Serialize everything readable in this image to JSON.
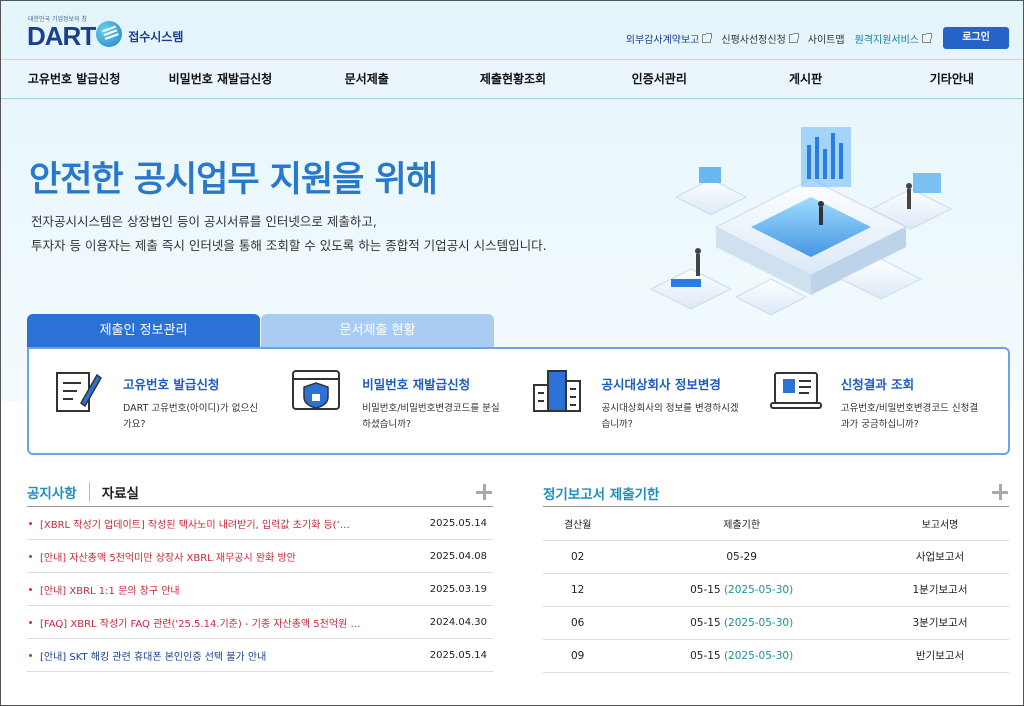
{
  "header": {
    "logo_tagline": "대한민국 기업정보의 창",
    "logo_text": "DART",
    "logo_sub": "접수시스템",
    "links": [
      {
        "label": "외부감사계약보고",
        "external": true
      },
      {
        "label": "신평사선정신청",
        "external": true
      },
      {
        "label": "사이트맵",
        "external": false
      },
      {
        "label": "원격지원서비스",
        "external": true
      }
    ],
    "login_label": "로그인"
  },
  "nav": [
    "고유번호 발급신청",
    "비밀번호 재발급신청",
    "문서제출",
    "제출현황조회",
    "인증서관리",
    "게시판",
    "기타안내"
  ],
  "hero": {
    "title": "안전한 공시업무 지원을 위해",
    "desc_line1": "전자공시시스템은 상장법인 등이 공시서류를 인터넷으로 제출하고,",
    "desc_line2": "투자자 등 이용자는 제출 즉시 인터넷을 통해 조회할 수 있도록 하는 종합적 기업공시 시스템입니다."
  },
  "tabs": {
    "active": "제출인 정보관리",
    "inactive": "문서제출 현황"
  },
  "services": [
    {
      "icon": "scroll-pen-icon",
      "title": "고유번호 발급신청",
      "desc": "DART 고유번호(아이디)가 없으신가요?"
    },
    {
      "icon": "lock-browser-icon",
      "title": "비밀번호 재발급신청",
      "desc": "비밀번호/비밀번호변경코드를 분실하셨습니까?"
    },
    {
      "icon": "buildings-icon",
      "title": "공시대상회사 정보변경",
      "desc": "공시대상회사의 정보를 변경하시겠습니까?"
    },
    {
      "icon": "laptop-document-icon",
      "title": "신청결과 조회",
      "desc": "고유번호/비밀번호변경코드 신청결과가 궁금하십니까?"
    }
  ],
  "notice": {
    "tab1": "공지사항",
    "tab2": "자료실",
    "items": [
      {
        "title": "[XBRL 작성기 업데이트] 작성된 택사노미 내려받기, 입력값 초기화 등(’…",
        "date": "2025.05.14",
        "color": "red"
      },
      {
        "title": "[안내] 자산총액 5천억미만 상장사 XBRL 재무공시 완화 방안",
        "date": "2025.04.08",
        "color": "red"
      },
      {
        "title": "[안내] XBRL 1:1 문의 창구 안내",
        "date": "2025.03.19",
        "color": "red"
      },
      {
        "title": "[FAQ] XBRL 작성기 FAQ 관련('25.5.14.기준) - 기종 자산총액 5천억원 …",
        "date": "2024.04.30",
        "color": "red"
      },
      {
        "title": "[안내] SKT 해킹 관련 휴대폰 본인인증 선택 불가 안내",
        "date": "2025.05.14",
        "color": "navy"
      }
    ]
  },
  "deadline": {
    "title": "정기보고서 제출기한",
    "headers": [
      "결산월",
      "제출기한",
      "보고서명"
    ],
    "rows": [
      {
        "month": "02",
        "due": "05-29",
        "extended": "",
        "report": "사업보고서"
      },
      {
        "month": "12",
        "due": "05-15",
        "extended": "(2025-05-30)",
        "report": "1분기보고서"
      },
      {
        "month": "06",
        "due": "05-15",
        "extended": "(2025-05-30)",
        "report": "3분기보고서"
      },
      {
        "month": "09",
        "due": "05-15",
        "extended": "(2025-05-30)",
        "report": "반기보고서"
      }
    ]
  }
}
